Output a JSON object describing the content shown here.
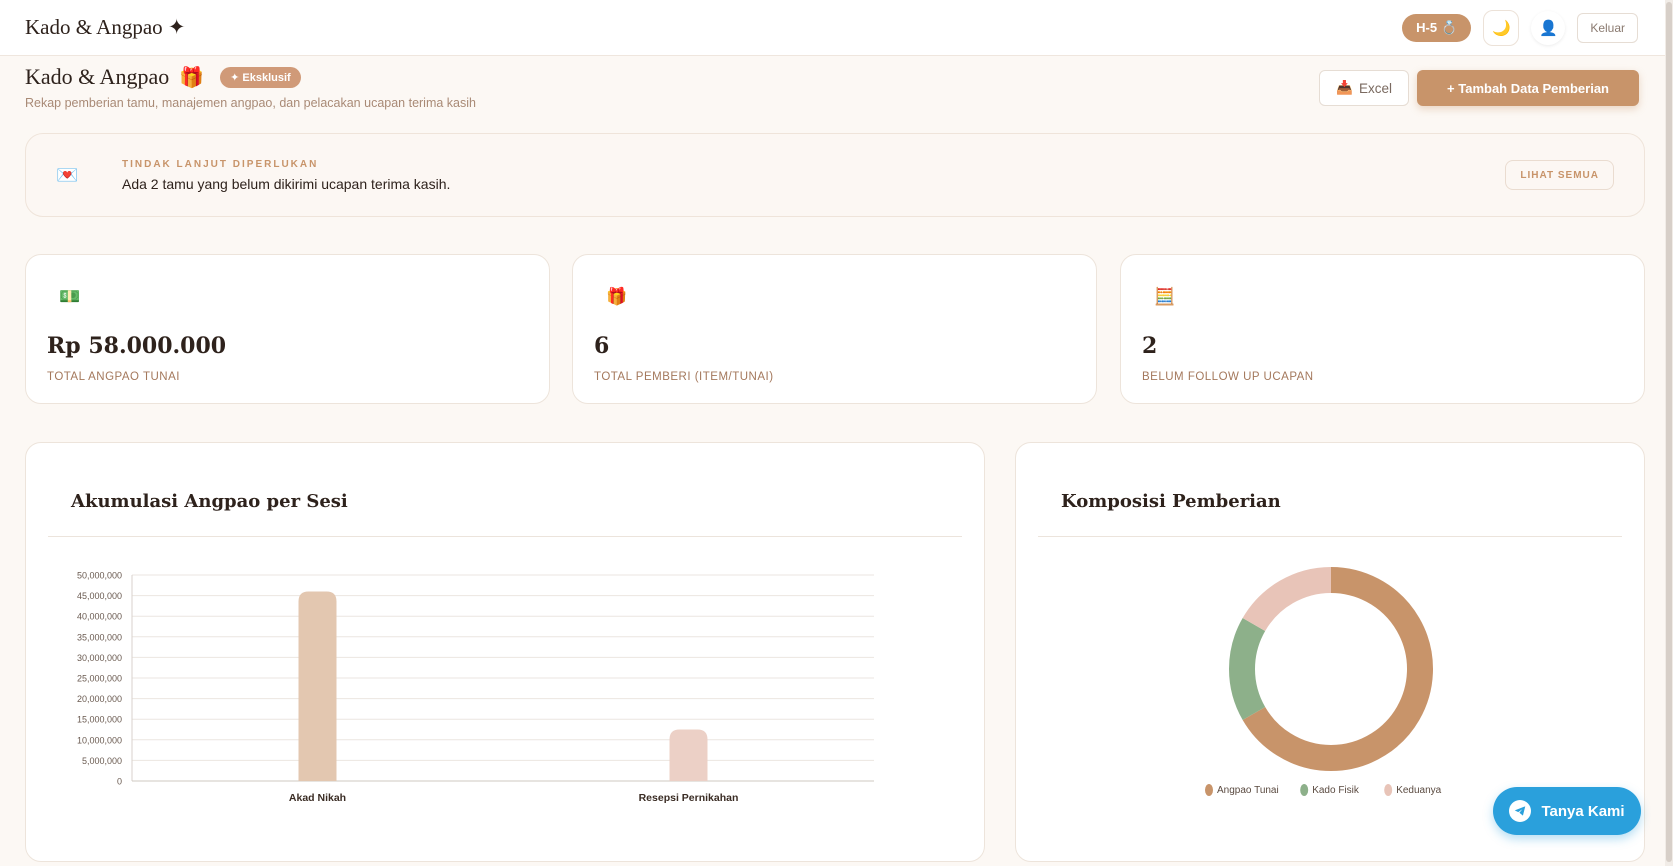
{
  "topbar": {
    "brand": "Kado & Angpao ✦",
    "countdown": "H-5",
    "countdown_icon": "💍",
    "theme_icon": "🌙",
    "user_icon": "👤",
    "logout_label": "Keluar"
  },
  "header": {
    "title": "Kado & Angpao",
    "title_icon": "🎁",
    "badge": "✦ Eksklusif",
    "subtitle": "Rekap pemberian tamu, manajemen angpao, dan pelacakan ucapan terima kasih",
    "excel_icon": "📥",
    "excel_label": "Excel",
    "add_label": "+ Tambah Data Pemberian"
  },
  "alert": {
    "icon": "💌",
    "kicker": "TINDAK LANJUT DIPERLUKAN",
    "message": "Ada 2 tamu yang belum dikirimi ucapan terima kasih.",
    "link_label": "LIHAT SEMUA"
  },
  "stats": [
    {
      "icon": "💵",
      "value": "Rp 58.000.000",
      "label": "TOTAL ANGPAO TUNAI"
    },
    {
      "icon": "🎁",
      "value": "6",
      "label": "TOTAL PEMBERI (ITEM/TUNAI)"
    },
    {
      "icon": "🧮",
      "value": "2",
      "label": "BELUM FOLLOW UP UCAPAN"
    }
  ],
  "bar_panel": {
    "title": "Akumulasi Angpao per Sesi"
  },
  "donut_panel": {
    "title": "Komposisi Pemberian"
  },
  "chart_data": [
    {
      "type": "bar",
      "title": "Akumulasi Angpao per Sesi",
      "categories": [
        "Akad Nikah",
        "Resepsi Pernikahan"
      ],
      "values": [
        46000000,
        12500000
      ],
      "colors": [
        "#e3c7b0",
        "#ecd0c6"
      ],
      "ylim": [
        0,
        50000000
      ],
      "yticks": [
        "0",
        "5,000,000",
        "10,000,000",
        "15,000,000",
        "20,000,000",
        "25,000,000",
        "30,000,000",
        "35,000,000",
        "40,000,000",
        "45,000,000",
        "50,000,000"
      ],
      "grid": true
    },
    {
      "type": "pie",
      "title": "Komposisi Pemberian",
      "categories": [
        "Angpao Tunai",
        "Kado Fisik",
        "Keduanya"
      ],
      "values": [
        4,
        1,
        1
      ],
      "colors": [
        "#c8946a",
        "#8db08a",
        "#e8c4b8"
      ],
      "legend": "bottom"
    }
  ],
  "fab": {
    "label": "Tanya Kami"
  }
}
